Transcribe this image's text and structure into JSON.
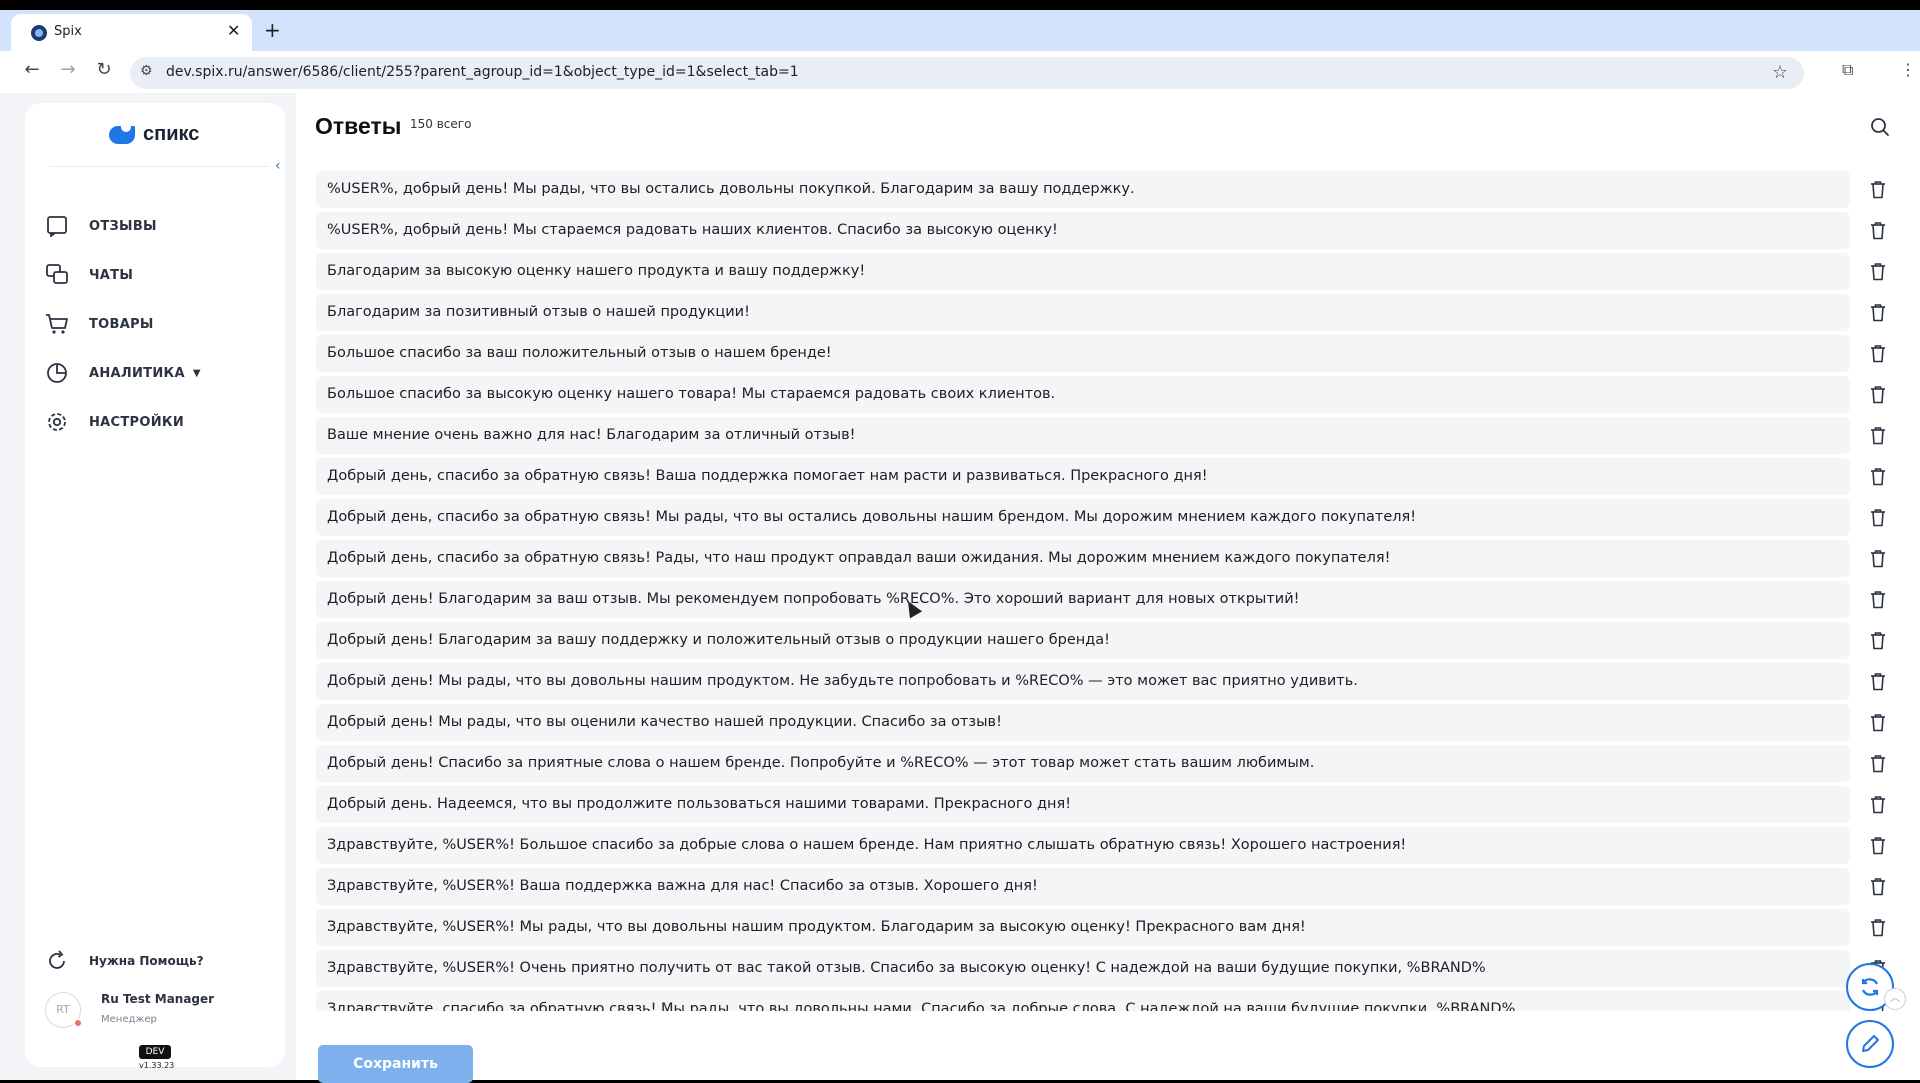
{
  "browser": {
    "tab_title": "Spix",
    "url": "dev.spix.ru/answer/6586/client/255?parent_agroup_id=1&object_type_id=1&select_tab=1"
  },
  "sidebar": {
    "logo_text": "спикс",
    "items": [
      {
        "label": "ОТЗЫВЫ",
        "icon": "reviews-icon"
      },
      {
        "label": "ЧАТЫ",
        "icon": "chats-icon"
      },
      {
        "label": "ТОВАРЫ",
        "icon": "cart-icon"
      },
      {
        "label": "АНАЛИТИКА",
        "icon": "analytics-icon"
      },
      {
        "label": "НАСТРОЙКИ",
        "icon": "settings-icon"
      }
    ],
    "help_label": "Нужна Помощь?",
    "user": {
      "initials": "RT",
      "name": "Ru Test Manager",
      "role": "Менеджер"
    },
    "env_badge": "DEV",
    "version": "v1.33.23"
  },
  "main": {
    "title": "Ответы",
    "count": "150 всего",
    "save_label": "Сохранить",
    "answers": [
      "%USER%, добрый день! Мы рады, что вы остались довольны покупкой. Благодарим за вашу поддержку.",
      "%USER%, добрый день! Мы стараемся радовать наших клиентов. Спасибо за высокую оценку!",
      "Благодарим за высокую оценку нашего продукта и вашу поддержку!",
      "Благодарим за позитивный отзыв о нашей продукции!",
      "Большое спасибо за ваш положительный отзыв о нашем бренде!",
      "Большое спасибо за высокую оценку нашего товара! Мы стараемся радовать своих клиентов.",
      "Ваше мнение очень важно для нас! Благодарим за отличный отзыв!",
      "Добрый день, спасибо за обратную связь! Ваша поддержка помогает нам расти и развиваться. Прекрасного дня!",
      "Добрый день, спасибо за обратную связь! Мы рады, что вы остались довольны нашим брендом. Мы дорожим мнением каждого покупателя!",
      "Добрый день, спасибо за обратную связь! Рады, что наш продукт оправдал ваши ожидания. Мы дорожим мнением каждого покупателя!",
      "Добрый день! Благодарим за ваш отзыв. Мы рекомендуем попробовать %RECO%. Это хороший вариант для новых открытий!",
      "Добрый день! Благодарим за вашу поддержку и положительный отзыв о продукции нашего бренда!",
      "Добрый день! Мы рады, что вы довольны нашим продуктом. Не забудьте попробовать и %RECO% — это может вас приятно удивить.",
      "Добрый день! Мы рады, что вы оценили качество нашей продукции. Спасибо за отзыв!",
      "Добрый день! Спасибо за приятные слова о нашем бренде. Попробуйте и %RECO% — этот товар может стать вашим любимым.",
      "Добрый день. Надеемся, что вы продолжите пользоваться нашими товарами. Прекрасного дня!",
      "Здравствуйте, %USER%! Большое спасибо за добрые слова о нашем бренде. Нам приятно слышать обратную связь! Хорошего настроения!",
      "Здравствуйте, %USER%! Ваша поддержка важна для нас! Спасибо за отзыв. Хорошего дня!",
      "Здравствуйте, %USER%! Мы рады, что вы довольны нашим продуктом. Благодарим за высокую оценку! Прекрасного вам дня!",
      "Здравствуйте, %USER%! Очень приятно получить от вас такой отзыв. Спасибо за высокую оценку! С надеждой на ваши будущие покупки, %BRAND%",
      "Здравствуйте, спасибо за обратную связь! Мы рады, что вы довольны нами. Спасибо за добрые слова. С надеждой на ваши будущие покупки, %BRAND%"
    ]
  },
  "colors": {
    "accent": "#1f76e6",
    "save_button": "#7fb0ee",
    "row_bg": "#f4f5f7"
  }
}
